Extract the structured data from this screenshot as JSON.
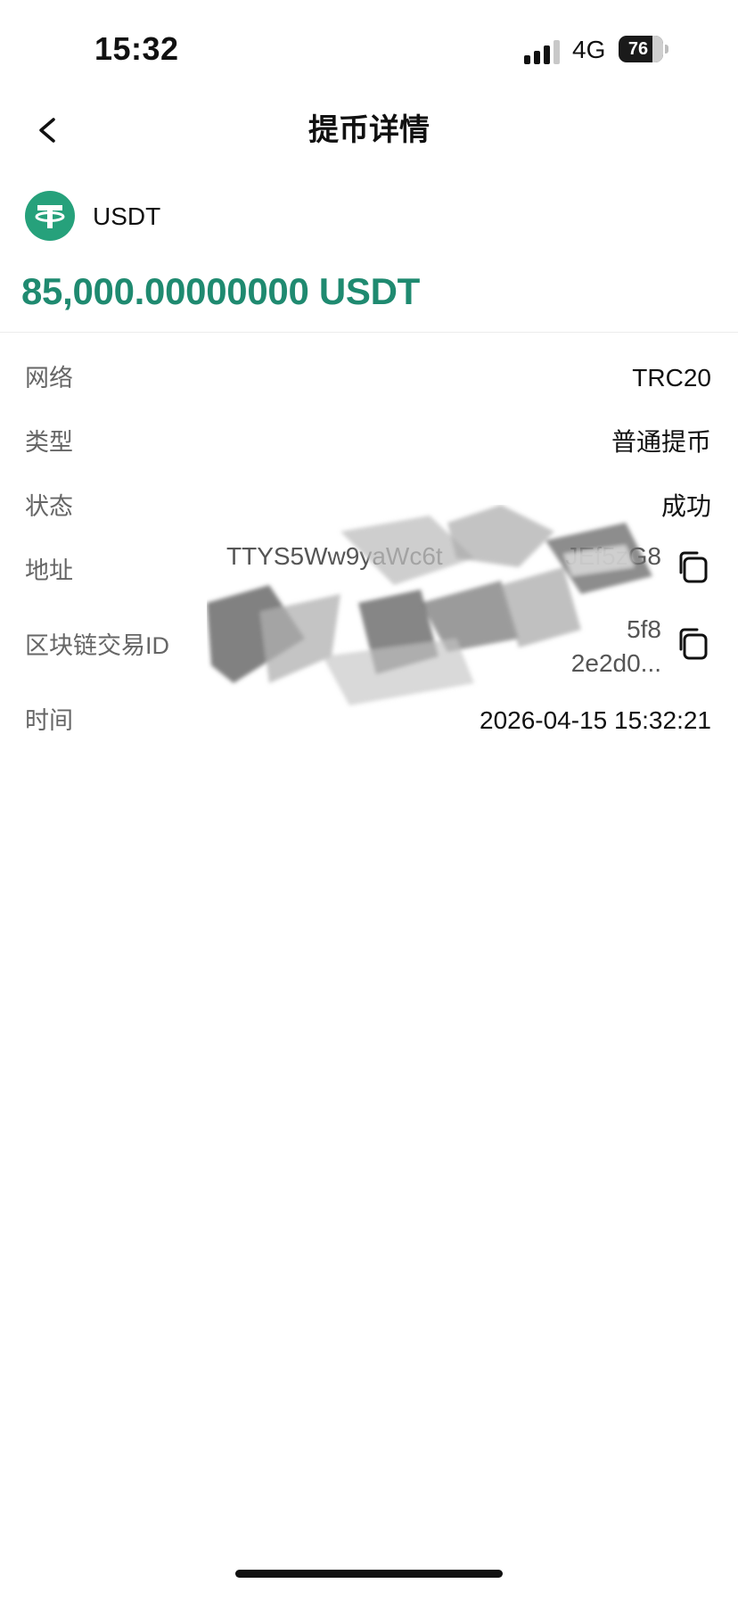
{
  "status_bar": {
    "time": "15:32",
    "network": "4G",
    "battery": "76",
    "battery_level": 0.76
  },
  "nav": {
    "title": "提币详情"
  },
  "asset": {
    "coin": "USDT",
    "amount": "85,000.00000000 USDT",
    "accent_color": "#1f8a70",
    "logo_color": "#26a17b"
  },
  "details": {
    "network_label": "网络",
    "network_value": "TRC20",
    "type_label": "类型",
    "type_value": "普通提币",
    "status_label": "状态",
    "status_value": "成功",
    "address_label": "地址",
    "address_value": "TTYS5Ww9yaWc6t",
    "address_tail": "JEf5zG8",
    "txid_label": "区块链交易ID",
    "txid_value_line1": "5f8",
    "txid_value_line2": "2e2d0...",
    "time_label": "时间",
    "time_value": "2026-04-15 15:32:21"
  },
  "icons": {
    "back": "chevron-left-icon",
    "copy": "copy-icon",
    "coin_logo": "tether-logo-icon"
  }
}
